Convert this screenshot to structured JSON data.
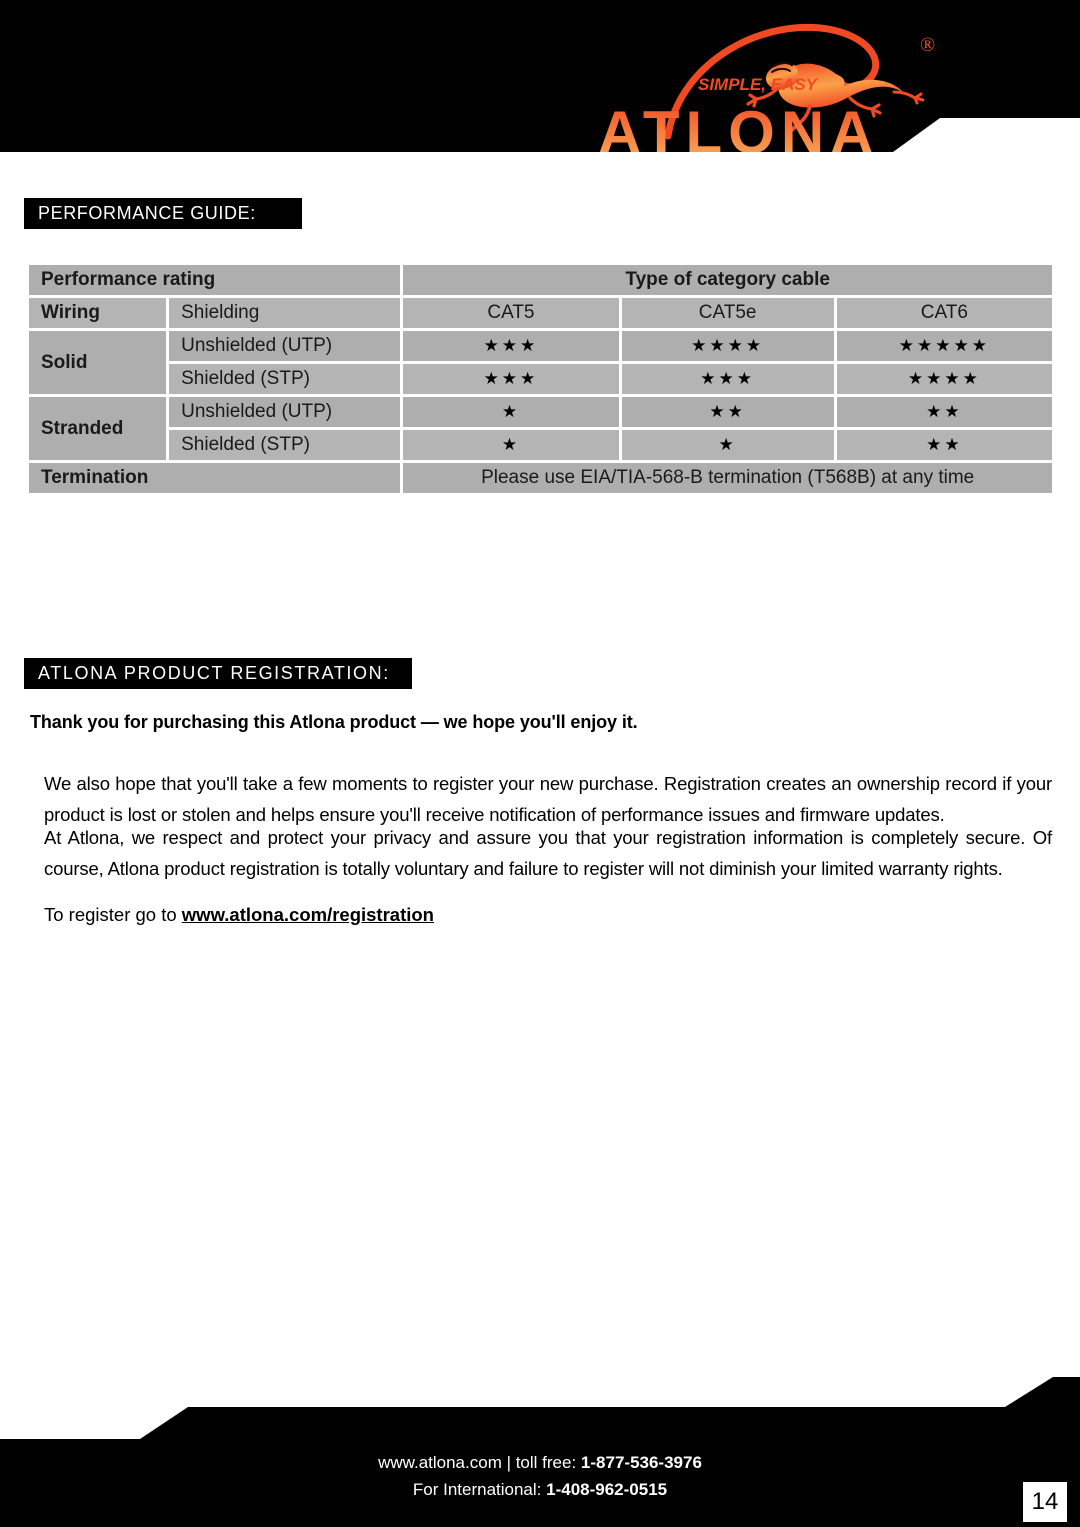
{
  "brand": {
    "logo_wordmark": "ATLONA",
    "tagline": "SIMPLE, EASY",
    "registered_mark": "®",
    "accent_color": "#F04A23",
    "accent_color_light": "#FBA24A"
  },
  "sections": {
    "performance_guide_label": "PERFORMANCE GUIDE:",
    "registration_label": "ATLONA  PRODUCT  REGISTRATION:"
  },
  "table": {
    "header": {
      "rating_label": "Performance rating",
      "category_label": "Type of category cable"
    },
    "subheader": {
      "wiring": "Wiring",
      "shielding": "Shielding",
      "cat5": "CAT5",
      "cat5e": "CAT5e",
      "cat6": "CAT6"
    },
    "rows": [
      {
        "group": "Solid",
        "type": "Unshielded (UTP)",
        "cat5": "★★★",
        "cat5e": "★★★★",
        "cat6": "★★★★★",
        "cat5_stars": 3,
        "cat5e_stars": 4,
        "cat6_stars": 5
      },
      {
        "group": "Solid",
        "type": "Shielded (STP)",
        "cat5": "★★★",
        "cat5e": "★★★",
        "cat6": "★★★★",
        "cat5_stars": 3,
        "cat5e_stars": 3,
        "cat6_stars": 4
      },
      {
        "group": "Stranded",
        "type": "Unshielded (UTP)",
        "cat5": "★",
        "cat5e": "★★",
        "cat6": "★★",
        "cat5_stars": 1,
        "cat5e_stars": 2,
        "cat6_stars": 2
      },
      {
        "group": "Stranded",
        "type": "Shielded (STP)",
        "cat5": "★",
        "cat5e": "★",
        "cat6": "★★",
        "cat5_stars": 1,
        "cat5e_stars": 1,
        "cat6_stars": 2
      }
    ],
    "group_labels": {
      "solid": "Solid",
      "stranded": "Stranded"
    },
    "termination": {
      "label": "Termination",
      "value": "Please use EIA/TIA-568-B termination (T568B) at any time"
    }
  },
  "registration": {
    "lede": "Thank you for purchasing this Atlona product — we hope you'll enjoy it.",
    "paragraph_1": "We also hope that you'll take a few moments to register your new purchase. Registration creates an ownership record if your product is lost or stolen and helps ensure you'll receive notification of performance issues and firmware updates.",
    "paragraph_2": "At Atlona, we respect and protect your privacy and assure you that your registration information is completely secure. Of course, Atlona product registration is totally voluntary and failure to register will not diminish your limited warranty rights.",
    "register_prefix": "To register go to ",
    "register_url": "www.atlona.com/registration"
  },
  "footer": {
    "line1_prefix": "www.atlona.com | toll free: ",
    "line1_phone": "1-877-536-3976",
    "line2_prefix": "For International: ",
    "line2_phone": "1-408-962-0515",
    "page_number": "14"
  }
}
